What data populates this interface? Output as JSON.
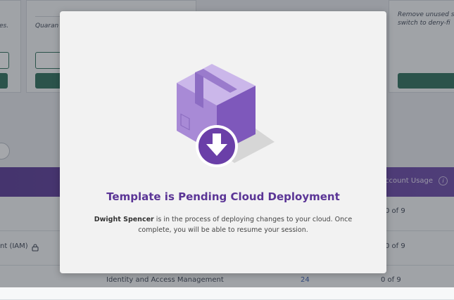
{
  "cards": [
    {
      "text": "es."
    },
    {
      "text": "Quaran"
    },
    {
      "text": "Remove unused s\nswitch to deny-fi"
    }
  ],
  "table": {
    "header_label": "ccount Usage",
    "info_glyph": "i",
    "rows": [
      {
        "name": "",
        "count": "",
        "usage": "0 of 9"
      },
      {
        "name": "nt (IAM)",
        "count": "",
        "usage": "0 of 9"
      },
      {
        "name": "Identity and Access Management",
        "count": "24",
        "usage": "0 of 9"
      }
    ]
  },
  "modal": {
    "title": "Template is Pending Cloud Deployment",
    "user_name": "Dwight Spencer",
    "message": " is in the process of deploying changes to your cloud. Once complete, you will be able to resume your session.",
    "illustration": "package-download-icon"
  },
  "colors": {
    "accent": "#5b3596",
    "header_bg": "#5a3a96",
    "button_green": "#2e6f5a",
    "box_light": "#b69ad9",
    "box_dark": "#7b55b8"
  }
}
